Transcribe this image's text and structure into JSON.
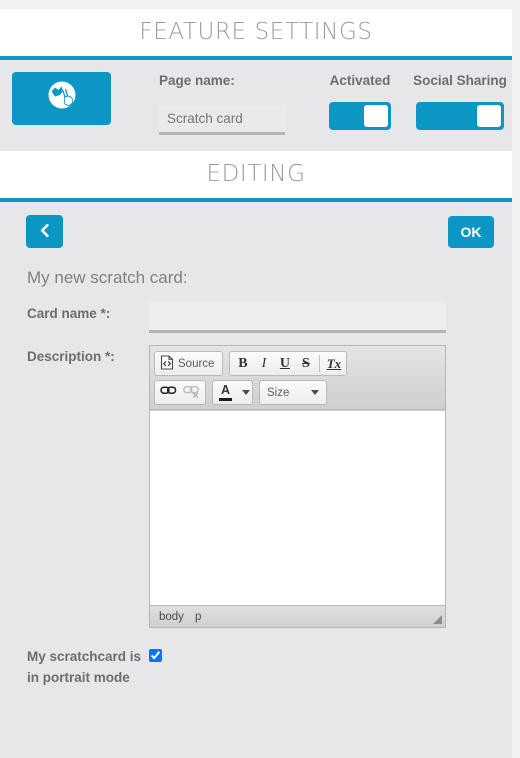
{
  "colors": {
    "accent": "#0c96c4",
    "panel_bg": "#e7e7e9",
    "title_text": "#9a9a9a",
    "label_text": "#6d6d6d"
  },
  "sections": {
    "feature_settings_title": "FEATURE SETTINGS",
    "editing_title": "EDITING"
  },
  "feature_settings": {
    "app_icon_name": "scratch-card-icon",
    "page_name_label": "Page name:",
    "page_name_value": "Scratch card",
    "page_name_placeholder": "Page name",
    "activated_label": "Activated",
    "activated_on": true,
    "social_sharing_label": "Social Sharing",
    "social_sharing_on": true
  },
  "editing": {
    "back_button_icon": "chevron-left-icon",
    "ok_button_label": "OK",
    "form_heading": "My new scratch card:",
    "card_name_label": "Card name *:",
    "card_name_value": "",
    "card_name_placeholder": "",
    "description_label": "Description *:",
    "portrait_label": "My scratchcard is in portrait mode",
    "portrait_checked": true
  },
  "editor": {
    "source_label": "Source",
    "bold_label": "B",
    "italic_label": "I",
    "underline_label": "U",
    "strike_label": "S",
    "removeformat_label": "Tx",
    "link_icon": "link-icon",
    "unlink_icon": "unlink-icon",
    "textcolor_label": "A",
    "size_label": "Size",
    "content": "",
    "path_body": "body",
    "path_p": "p",
    "resize_icon": "resize-handle-icon"
  }
}
